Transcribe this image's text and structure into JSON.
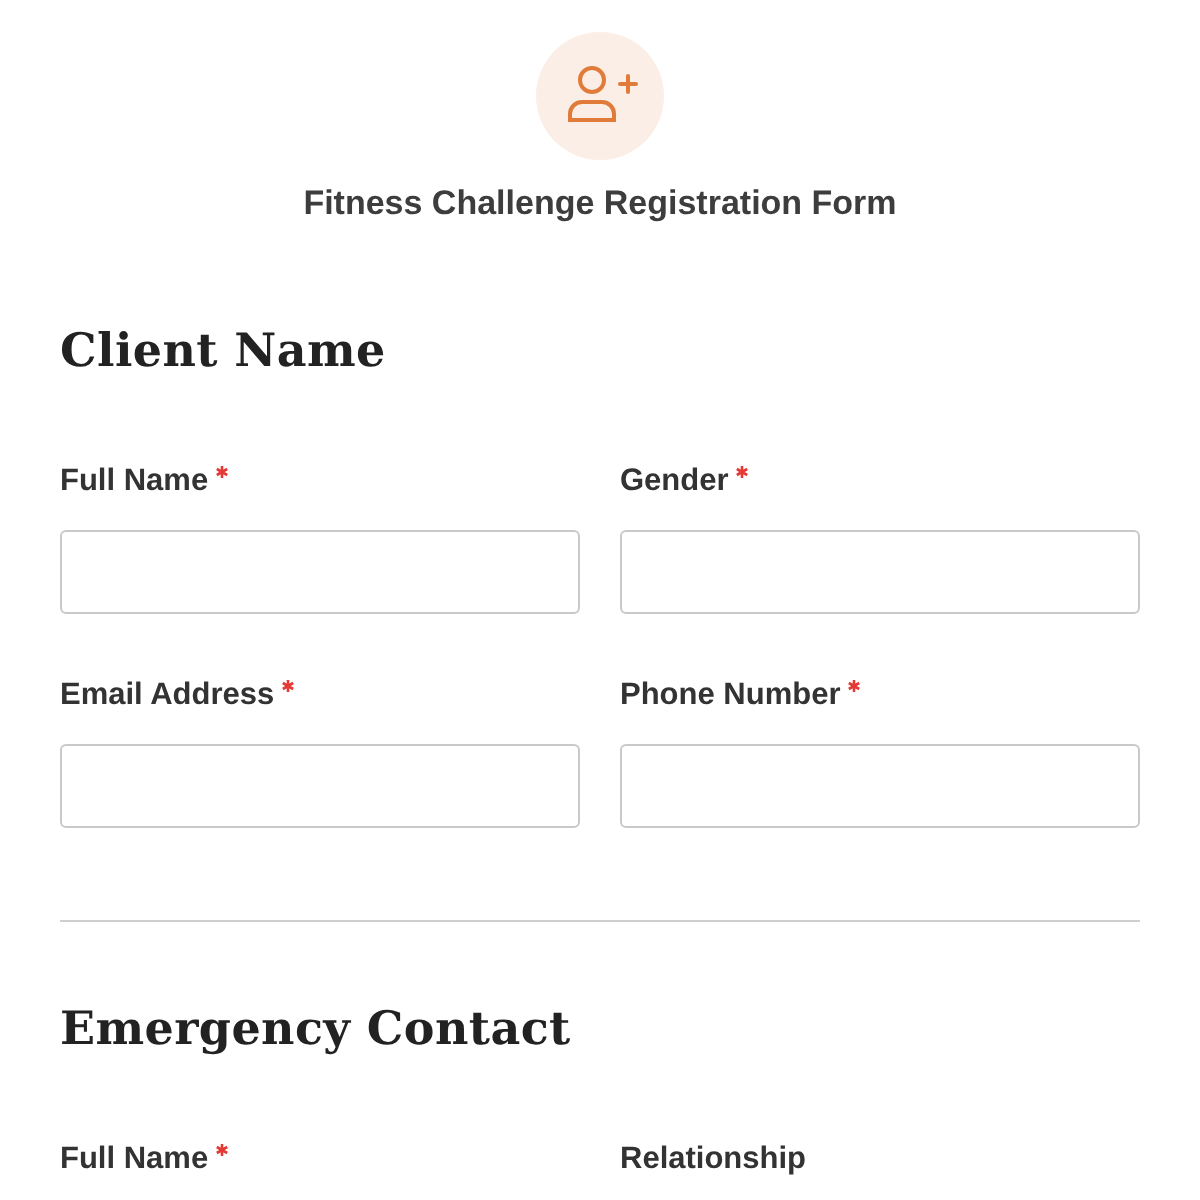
{
  "form": {
    "title": "Fitness Challenge Registration Form"
  },
  "sections": [
    {
      "heading": "Client Name",
      "divider_after": true,
      "fields": [
        {
          "label": "Full Name",
          "required": true,
          "input": true
        },
        {
          "label": "Gender",
          "required": true,
          "input": true
        },
        {
          "label": "Email Address",
          "required": true,
          "input": true
        },
        {
          "label": "Phone Number",
          "required": true,
          "input": true
        }
      ]
    },
    {
      "heading": "Emergency Contact",
      "divider_after": false,
      "fields": [
        {
          "label": "Full Name",
          "required": true,
          "input": false
        },
        {
          "label": "Relationship",
          "required": false,
          "input": false
        }
      ]
    }
  ]
}
